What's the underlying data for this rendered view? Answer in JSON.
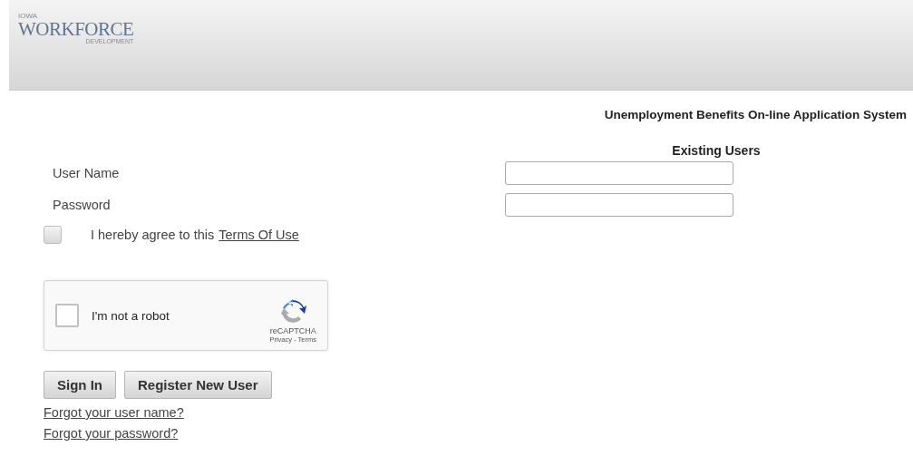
{
  "logo": {
    "top": "IOWA",
    "main": "WORKFORCE",
    "sub": "DEVELOPMENT"
  },
  "title": "Unemployment Benefits On-line Application System",
  "section": "Existing Users",
  "fields": [
    {
      "label": "User Name"
    },
    {
      "label": "Password"
    }
  ],
  "terms": {
    "checked": false,
    "text": "I hereby agree to this",
    "link": "Terms Of Use"
  },
  "captcha": {
    "checked": false,
    "label": "I'm not a robot",
    "brand": "reCAPTCHA",
    "privacy": "Privacy",
    "separator": "-",
    "terms": "Terms"
  },
  "buttons": [
    "Sign In",
    "Register New User"
  ],
  "links": [
    "Forgot your user name?",
    "Forgot your password?"
  ]
}
